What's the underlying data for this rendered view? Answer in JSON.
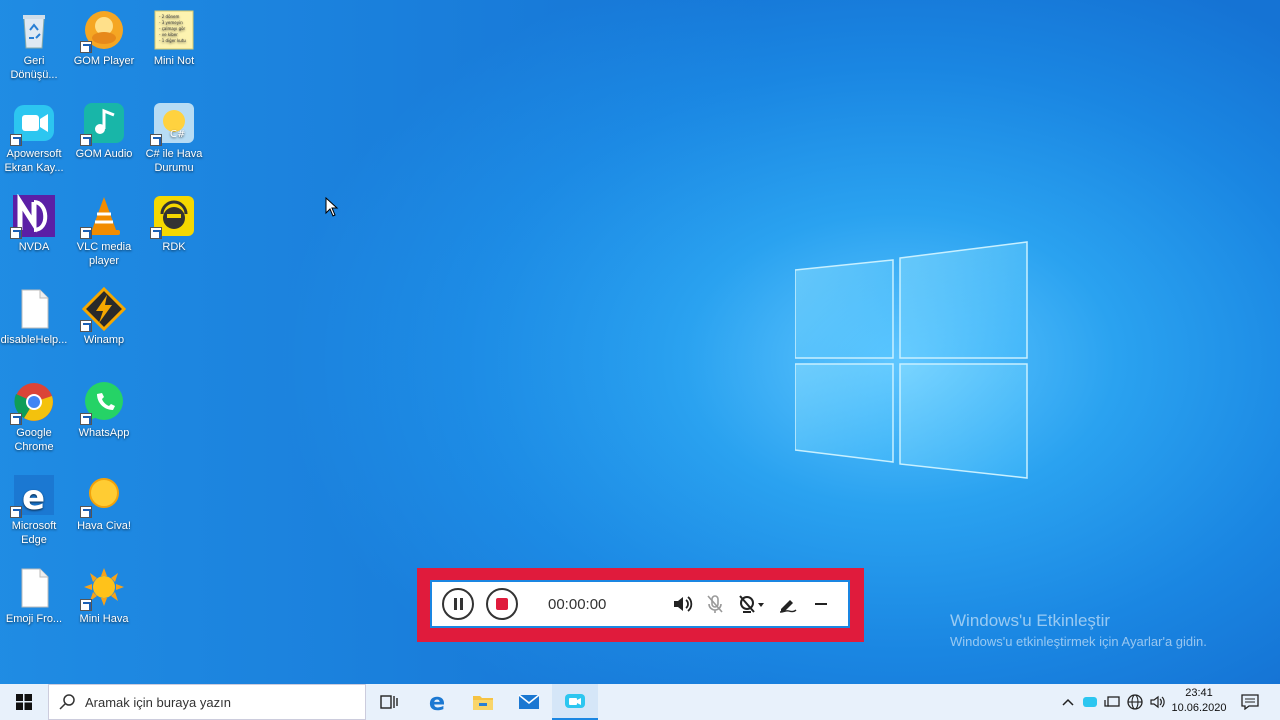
{
  "desktop": {
    "icons": [
      {
        "label": "Geri\nDönüşü..."
      },
      {
        "label": "GOM Player"
      },
      {
        "label": "Mini Not"
      },
      {
        "label": "Apowersoft\nEkran Kay..."
      },
      {
        "label": "GOM Audio"
      },
      {
        "label": "C# ile Hava\nDurumu"
      },
      {
        "label": "NVDA"
      },
      {
        "label": "VLC media\nplayer"
      },
      {
        "label": "RDK"
      },
      {
        "label": "disableHelp..."
      },
      {
        "label": "Winamp"
      },
      {
        "label": "Google\nChrome"
      },
      {
        "label": "WhatsApp"
      },
      {
        "label": "Microsoft\nEdge"
      },
      {
        "label": "Hava Civa!"
      },
      {
        "label": "Emoji Fro..."
      },
      {
        "label": "Mini Hava"
      }
    ],
    "mini_note_text": [
      "- 2 dönem",
      "- 3 yemeyin",
      "- çalmayı gör",
      "- ve kiber",
      "- 1 diğer kutu"
    ]
  },
  "recorder": {
    "timer": "00:00:00",
    "highlight_color": "#e01b3c",
    "icons": [
      "pause-icon",
      "stop-icon",
      "speaker-icon",
      "microphone-muted-icon",
      "webcam-off-icon",
      "pen-icon",
      "minimize-icon"
    ]
  },
  "activation": {
    "title": "Windows'u Etkinleştir",
    "subtitle": "Windows'u etkinleştirmek için Ayarlar'a gidin."
  },
  "taskbar": {
    "search_placeholder": "Aramak için buraya yazın",
    "clock_time": "23:41",
    "clock_date": "10.06.2020"
  }
}
